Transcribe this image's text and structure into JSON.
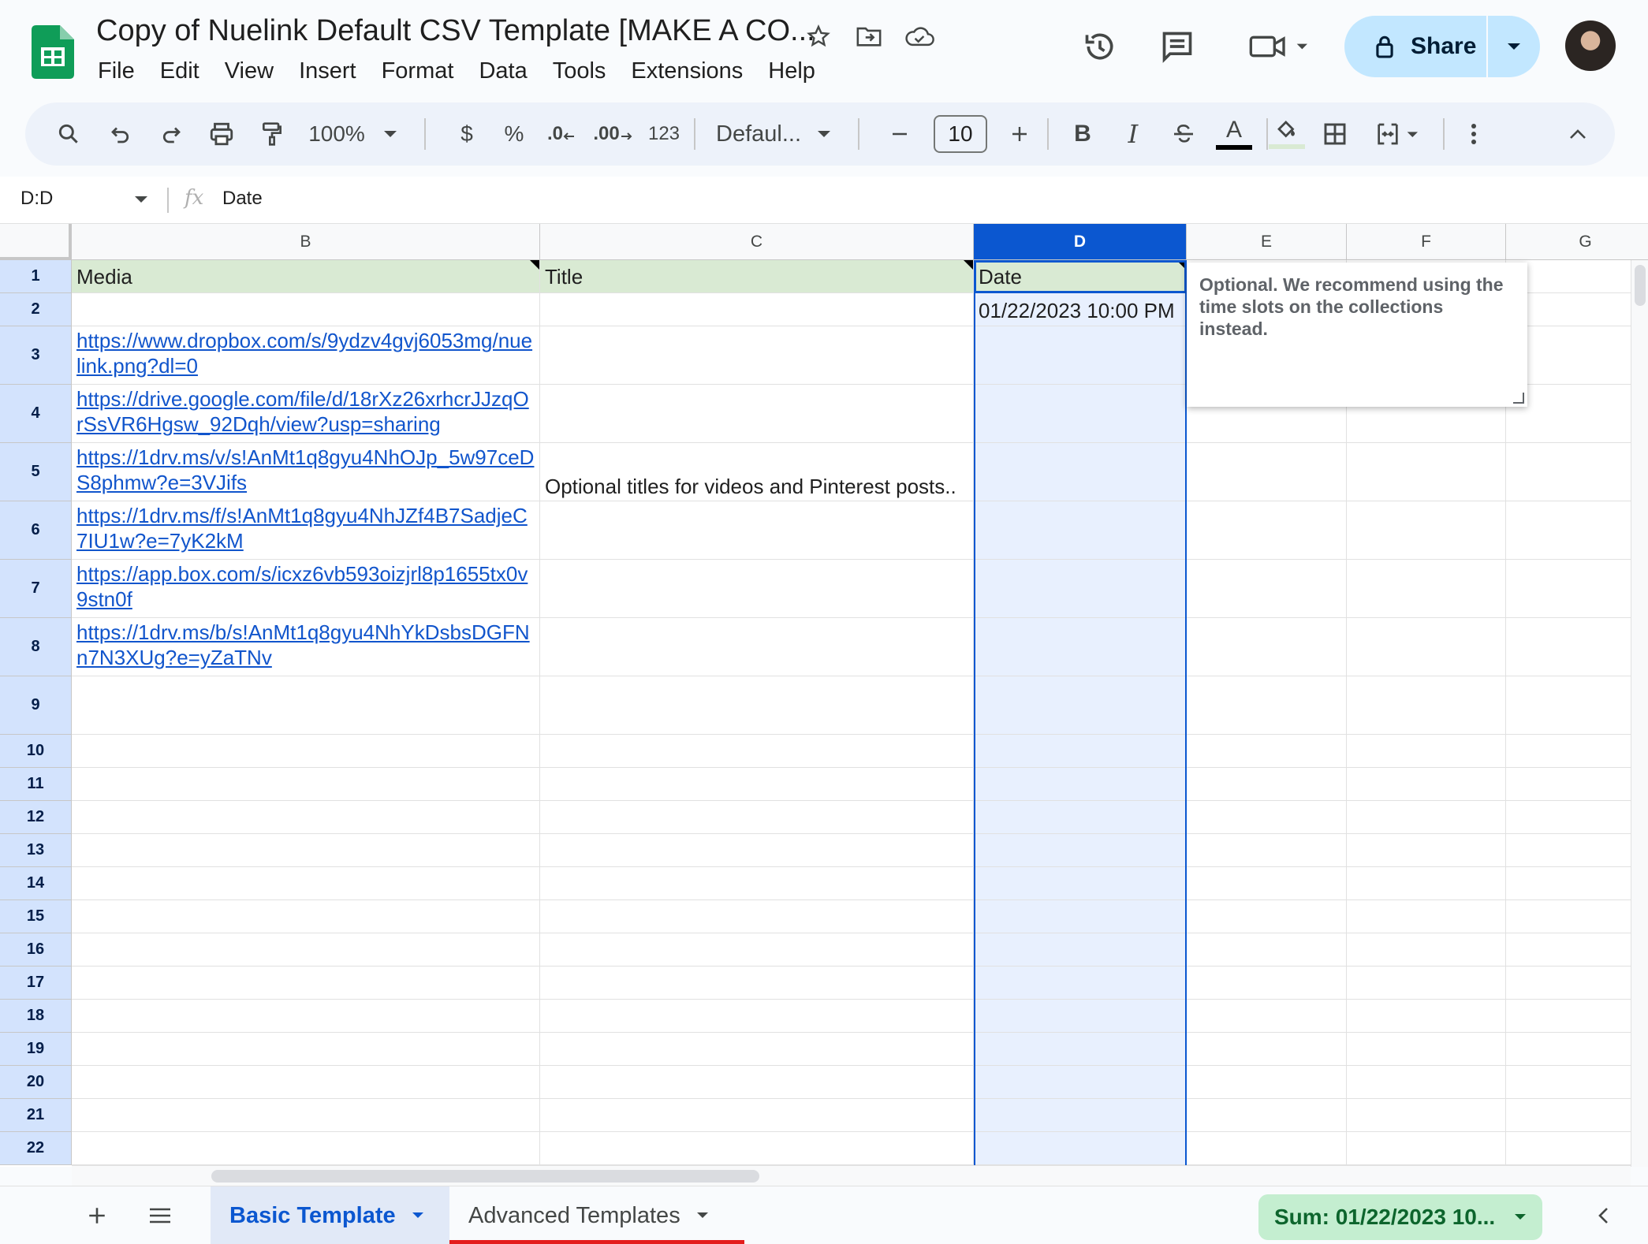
{
  "app": {
    "doc_title": "Copy of Nuelink Default CSV Template [MAKE A CO...",
    "menu": [
      "File",
      "Edit",
      "View",
      "Insert",
      "Format",
      "Data",
      "Tools",
      "Extensions",
      "Help"
    ],
    "share_label": "Share",
    "brand_color": "#0f9d58",
    "accent_color": "#0b57d0"
  },
  "toolbar": {
    "zoom": "100%",
    "currency": "$",
    "percent": "%",
    "decrease_decimal": ".0",
    "increase_decimal": ".00",
    "number_format": "123",
    "font": "Defaul...",
    "font_size": "10",
    "bold": "B",
    "italic": "I",
    "text_color": "A",
    "icons": [
      "search-icon",
      "undo-icon",
      "redo-icon",
      "print-icon",
      "paint-format-icon",
      "strikethrough-icon",
      "fill-color-icon",
      "borders-icon",
      "merge-cells-icon",
      "more-icon",
      "collapse-icon"
    ]
  },
  "formula_bar": {
    "name_box": "D:D",
    "fx": "fx",
    "content": "Date"
  },
  "sheet": {
    "columns": [
      "B",
      "C",
      "D",
      "E",
      "F",
      "G"
    ],
    "selected_column": "D",
    "rows": [
      "1",
      "2",
      "3",
      "4",
      "5",
      "6",
      "7",
      "8",
      "9",
      "10",
      "11",
      "12",
      "13",
      "14",
      "15",
      "16",
      "17",
      "18",
      "19",
      "20",
      "21",
      "22"
    ],
    "headers": {
      "B": "Media",
      "C": "Title",
      "D": "Date"
    },
    "date_value": "01/22/2023 10:00 PM",
    "links": [
      "https://www.dropbox.com/s/9ydzv4gvj6053mg/nuelink.png?dl=0",
      "https://drive.google.com/file/d/18rXz26xrhcrJJzqOrSsVR6Hgsw_92Dqh/view?usp=sharing",
      "https://1drv.ms/v/s!AnMt1q8gyu4NhOJp_5w97ceDS8phmw?e=3VJifs",
      "https://1drv.ms/f/s!AnMt1q8gyu4NhJZf4B7SadjeC7IU1w?e=7yK2kM",
      "https://app.box.com/s/icxz6vb593oizjrl8p1655tx0v9stn0f",
      "https://1drv.ms/b/s!AnMt1q8gyu4NhYkDsbsDGFNn7N3XUg?e=yZaTNv"
    ],
    "title_row5": "Optional titles for videos and Pinterest posts..",
    "note_text": "Optional. We recommend using the time slots on the collections instead."
  },
  "tabs": {
    "items": [
      "Basic Template",
      "Advanced Templates"
    ],
    "active": "Basic Template",
    "sum": "Sum: 01/22/2023 10..."
  }
}
